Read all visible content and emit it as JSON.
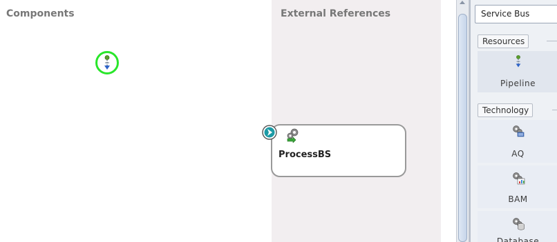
{
  "canvas": {
    "components_title": "Components",
    "external_refs_title": "External References",
    "card": {
      "label": "ProcessBS",
      "icon": "gear-icon"
    },
    "drop_target_icon": "pipeline-icon",
    "colors": {
      "drop_target_ring": "#29e62a",
      "external_lane_bg": "#f2eef0",
      "port_accent": "#1c9aa5"
    }
  },
  "palette": {
    "tab_label": "Service Bus",
    "sections": [
      {
        "title": "Resources",
        "items": [
          {
            "label": "Pipeline",
            "icon": "pipeline-icon"
          }
        ]
      },
      {
        "title": "Technology",
        "items": [
          {
            "label": "AQ",
            "icon": "aq-adapter-icon"
          },
          {
            "label": "BAM",
            "icon": "bam-adapter-icon"
          },
          {
            "label": "Database",
            "icon": "database-adapter-icon"
          }
        ]
      }
    ]
  }
}
